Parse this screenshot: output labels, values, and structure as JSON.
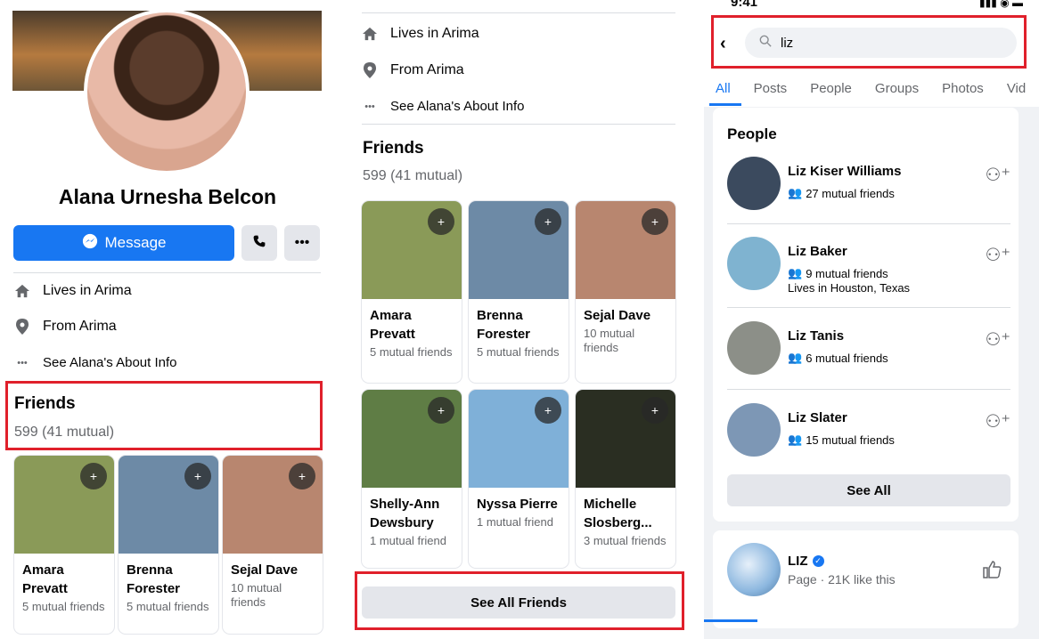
{
  "panel1": {
    "profile_name": "Alana Urnesha Belcon",
    "message_label": "Message",
    "info": [
      {
        "icon": "home-icon",
        "text": "Lives in Arima"
      },
      {
        "icon": "location-pin-icon",
        "text": "From Arima"
      },
      {
        "icon": "more-dots-icon",
        "text": "See Alana's About Info"
      }
    ],
    "friends_title": "Friends",
    "friends_count": "599 (41 mutual)",
    "friends": [
      {
        "name": "Amara Prevatt",
        "mutual": "5 mutual friends",
        "color": "#8a9a58"
      },
      {
        "name": "Brenna Forester",
        "mutual": "5 mutual friends",
        "color": "#6d8aa6"
      },
      {
        "name": "Sejal Dave",
        "mutual": "10 mutual friends",
        "color": "#b8866f"
      }
    ]
  },
  "panel2": {
    "info": [
      {
        "icon": "home-icon",
        "text": "Lives in Arima"
      },
      {
        "icon": "location-pin-icon",
        "text": "From Arima"
      },
      {
        "icon": "more-dots-icon",
        "text": "See Alana's About Info"
      }
    ],
    "friends_title": "Friends",
    "friends_count": "599 (41 mutual)",
    "friends": [
      {
        "name": "Amara Prevatt",
        "mutual": "5 mutual friends",
        "color": "#8a9a58"
      },
      {
        "name": "Brenna Forester",
        "mutual": "5 mutual friends",
        "color": "#6d8aa6"
      },
      {
        "name": "Sejal Dave",
        "mutual": "10 mutual friends",
        "color": "#b8866f"
      },
      {
        "name": "Shelly-Ann Dewsbury",
        "mutual": "1 mutual friend",
        "color": "#5f7d45"
      },
      {
        "name": "Nyssa Pierre",
        "mutual": "1 mutual friend",
        "color": "#7fb0d8"
      },
      {
        "name": "Michelle Slosberg...",
        "mutual": "3 mutual friends",
        "color": "#2a2e22"
      }
    ],
    "see_all_friends": "See All Friends"
  },
  "panel3": {
    "status_time": "9:41",
    "search_value": "liz",
    "tabs": [
      "All",
      "Posts",
      "People",
      "Groups",
      "Photos",
      "Vid"
    ],
    "people_title": "People",
    "people": [
      {
        "name": "Liz Kiser Williams",
        "mutual": "27 mutual friends",
        "location": "",
        "color": "#3b4a5e"
      },
      {
        "name": "Liz Baker",
        "mutual": "9 mutual friends",
        "location": "Lives in Houston, Texas",
        "color": "#7fb3d0"
      },
      {
        "name": "Liz Tanis",
        "mutual": "6 mutual friends",
        "location": "",
        "color": "#8c8f88"
      },
      {
        "name": "Liz Slater",
        "mutual": "15 mutual friends",
        "location": "",
        "color": "#7d97b5"
      }
    ],
    "see_all": "See All",
    "page_result": {
      "name": "LIZ",
      "subtitle": "Page · 21K like this"
    }
  }
}
